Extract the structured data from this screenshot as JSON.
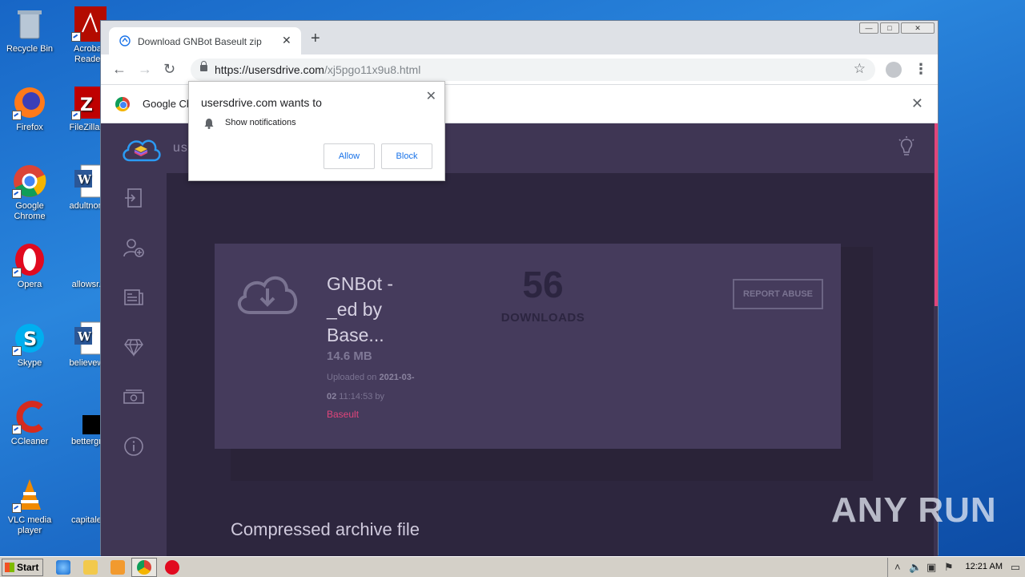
{
  "desktop": {
    "icons": [
      {
        "label": "Recycle Bin"
      },
      {
        "label": "Acrobat Reader"
      },
      {
        "label": "Firefox"
      },
      {
        "label": "FileZilla C"
      },
      {
        "label": "Google Chrome"
      },
      {
        "label": "adultnorm"
      },
      {
        "label": "Opera"
      },
      {
        "label": "allowsr.p"
      },
      {
        "label": "Skype"
      },
      {
        "label": "believewe"
      },
      {
        "label": "CCleaner"
      },
      {
        "label": "bettergro"
      },
      {
        "label": "VLC media player"
      },
      {
        "label": "capitaled"
      }
    ]
  },
  "browser": {
    "tab": {
      "title": "Download GNBot Baseult zip",
      "close": "✕"
    },
    "new_tab": "+",
    "url": {
      "host": "https://usersdrive.com",
      "path": "/xj5pgo11x9u8.html"
    },
    "infobar": {
      "text": "Google Ch",
      "close": "✕"
    },
    "window_controls": {
      "minimize": "—",
      "maximize": "□",
      "close": "✕"
    }
  },
  "popup": {
    "title": "usersdrive.com wants to",
    "permission": "Show notifications",
    "allow": "Allow",
    "block": "Block",
    "close": "✕"
  },
  "page": {
    "brand": "us",
    "file": {
      "name": "GNBot - _ed by Base...",
      "size": "14.6 MB",
      "uploaded_prefix": "Uploaded on ",
      "uploaded_date": "2021-03-02",
      "uploaded_time": " 11:14:53 by",
      "uploader": "Baseult"
    },
    "downloads": {
      "count": "56",
      "label": "DOWNLOADS"
    },
    "report_button": "REPORT ABUSE",
    "section_title": "Compressed archive file"
  },
  "watermark": "ANY RUN",
  "taskbar": {
    "start": "Start",
    "clock": "12:21 AM"
  },
  "colors": {
    "accent": "#e0457b",
    "page_bg": "#3c3350",
    "card_bg": "#453b5c"
  }
}
